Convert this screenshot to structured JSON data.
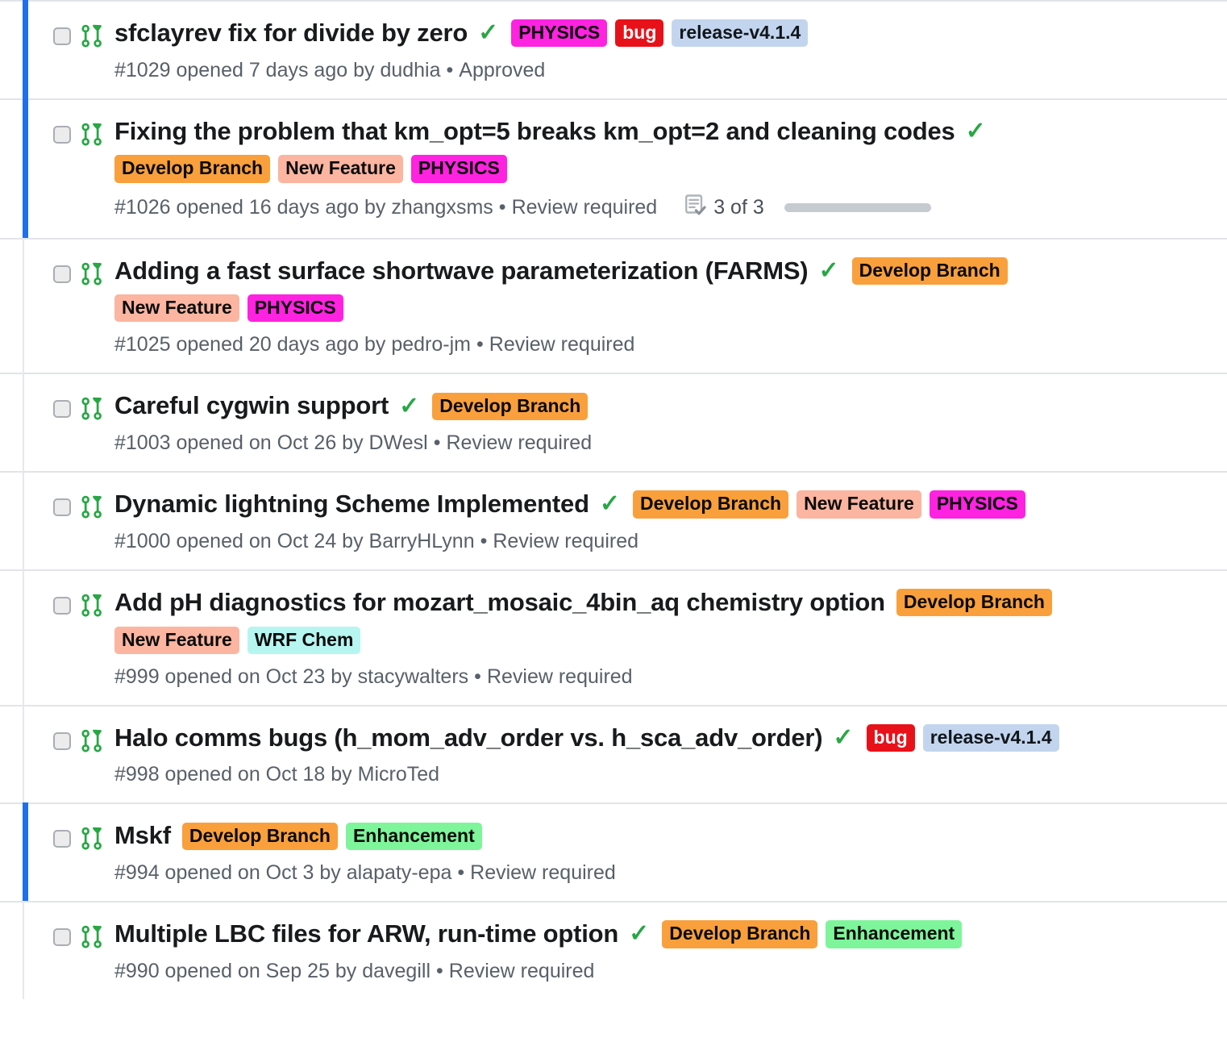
{
  "list": {
    "name": "pull-request-list",
    "icons": {
      "pull_request": "git-pull-request-icon",
      "checkbox": "row-checkbox",
      "approved_check": "check-icon",
      "tasks": "tasklist-icon"
    },
    "check_glyph": "✓",
    "separator_dot": "•",
    "colors": {
      "flag_bar": "#1f6feb",
      "pr_icon_green": "#28a745",
      "check_green": "#28a745",
      "row_border": "#e1e4e8",
      "meta_text": "#586069",
      "title_text": "#181a1c",
      "label_develop_branch_bg": "#f9a03c",
      "label_new_feature_bg": "#fbb5a0",
      "label_physics_bg": "#ff22e0",
      "label_bug_bg": "#e8111a",
      "label_bug_fg": "#ffffff",
      "label_release_bg": "#c3d5ee",
      "label_wrf_chem_bg": "#b6f5f0",
      "label_enhancement_bg": "#7ef59a",
      "progress_track": "#c6cbd1"
    },
    "rows": [
      {
        "flagged": true,
        "title": "sfclayrev fix for divide by zero",
        "approved_check": true,
        "labels_inline": [
          {
            "text": "PHYSICS",
            "bg": "#ff22e0",
            "fg": "#0a0a0a"
          },
          {
            "text": "bug",
            "bg": "#e8111a",
            "fg": "#ffffff"
          },
          {
            "text": "release-v4.1.4",
            "bg": "#c3d5ee",
            "fg": "#11161b"
          }
        ],
        "labels_wrapped": [],
        "number": "#1029",
        "meta": "#1029 opened 7 days ago by dudhia",
        "status": "Approved",
        "tasks": null
      },
      {
        "flagged": true,
        "title": "Fixing the problem that km_opt=5 breaks km_opt=2 and cleaning codes",
        "approved_check": true,
        "labels_inline": [],
        "labels_wrapped": [
          {
            "text": "Develop Branch",
            "bg": "#f9a03c",
            "fg": "#0a0a0a"
          },
          {
            "text": "New Feature",
            "bg": "#fbb5a0",
            "fg": "#0a0a0a"
          },
          {
            "text": "PHYSICS",
            "bg": "#ff22e0",
            "fg": "#0a0a0a"
          }
        ],
        "number": "#1026",
        "meta": "#1026 opened 16 days ago by zhangxsms",
        "status": "Review required",
        "tasks": {
          "count": "3 of 3",
          "progress": 100
        }
      },
      {
        "flagged": false,
        "title": "Adding a fast surface shortwave parameterization (FARMS)",
        "approved_check": true,
        "labels_inline": [
          {
            "text": "Develop Branch",
            "bg": "#f9a03c",
            "fg": "#0a0a0a"
          }
        ],
        "labels_wrapped": [
          {
            "text": "New Feature",
            "bg": "#fbb5a0",
            "fg": "#0a0a0a"
          },
          {
            "text": "PHYSICS",
            "bg": "#ff22e0",
            "fg": "#0a0a0a"
          }
        ],
        "number": "#1025",
        "meta": "#1025 opened 20 days ago by pedro-jm",
        "status": "Review required",
        "tasks": null
      },
      {
        "flagged": false,
        "title": "Careful cygwin support",
        "approved_check": true,
        "labels_inline": [
          {
            "text": "Develop Branch",
            "bg": "#f9a03c",
            "fg": "#0a0a0a"
          }
        ],
        "labels_wrapped": [],
        "number": "#1003",
        "meta": "#1003 opened on Oct 26 by DWesl",
        "status": "Review required",
        "tasks": null
      },
      {
        "flagged": false,
        "title": "Dynamic lightning Scheme Implemented",
        "approved_check": true,
        "labels_inline": [
          {
            "text": "Develop Branch",
            "bg": "#f9a03c",
            "fg": "#0a0a0a"
          },
          {
            "text": "New Feature",
            "bg": "#fbb5a0",
            "fg": "#0a0a0a"
          },
          {
            "text": "PHYSICS",
            "bg": "#ff22e0",
            "fg": "#0a0a0a"
          }
        ],
        "labels_wrapped": [],
        "number": "#1000",
        "meta": "#1000 opened on Oct 24 by BarryHLynn",
        "status": "Review required",
        "tasks": null
      },
      {
        "flagged": false,
        "title": "Add pH diagnostics for mozart_mosaic_4bin_aq chemistry option",
        "approved_check": false,
        "labels_inline": [
          {
            "text": "Develop Branch",
            "bg": "#f9a03c",
            "fg": "#0a0a0a"
          }
        ],
        "labels_wrapped": [
          {
            "text": "New Feature",
            "bg": "#fbb5a0",
            "fg": "#0a0a0a"
          },
          {
            "text": "WRF Chem",
            "bg": "#b6f5f0",
            "fg": "#0a0a0a"
          }
        ],
        "number": "#999",
        "meta": "#999 opened on Oct 23 by stacywalters",
        "status": "Review required",
        "tasks": null
      },
      {
        "flagged": false,
        "title": "Halo comms bugs (h_mom_adv_order vs. h_sca_adv_order)",
        "approved_check": true,
        "labels_inline": [
          {
            "text": "bug",
            "bg": "#e8111a",
            "fg": "#ffffff"
          },
          {
            "text": "release-v4.1.4",
            "bg": "#c3d5ee",
            "fg": "#11161b"
          }
        ],
        "labels_wrapped": [],
        "number": "#998",
        "meta": "#998 opened on Oct 18 by MicroTed",
        "status": "",
        "tasks": null
      },
      {
        "flagged": true,
        "title": "Mskf",
        "approved_check": false,
        "labels_inline": [
          {
            "text": "Develop Branch",
            "bg": "#f9a03c",
            "fg": "#0a0a0a"
          },
          {
            "text": "Enhancement",
            "bg": "#7ef59a",
            "fg": "#0a0a0a"
          }
        ],
        "labels_wrapped": [],
        "number": "#994",
        "meta": "#994 opened on Oct 3 by alapaty-epa",
        "status": "Review required",
        "tasks": null
      },
      {
        "flagged": false,
        "title": "Multiple LBC files for ARW, run-time option",
        "approved_check": true,
        "labels_inline": [
          {
            "text": "Develop Branch",
            "bg": "#f9a03c",
            "fg": "#0a0a0a"
          },
          {
            "text": "Enhancement",
            "bg": "#7ef59a",
            "fg": "#0a0a0a"
          }
        ],
        "labels_wrapped": [],
        "number": "#990",
        "meta": "#990 opened on Sep 25 by davegill",
        "status": "Review required",
        "tasks": null
      }
    ]
  }
}
